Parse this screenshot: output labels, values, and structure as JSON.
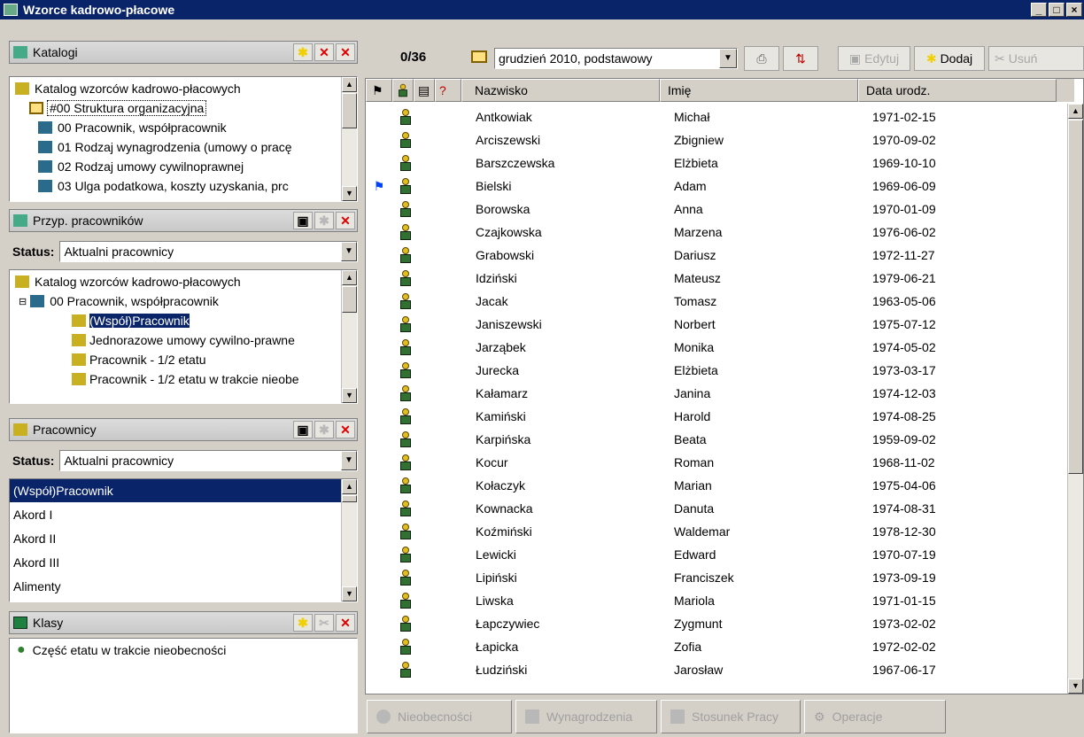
{
  "window": {
    "title": "Wzorce kadrowo-płacowe"
  },
  "katalogi": {
    "title": "Katalogi",
    "items": [
      "Katalog wzorców kadrowo-płacowych",
      "#00 Struktura organizacyjna",
      "00 Pracownik, współpracownik",
      "01 Rodzaj wynagrodzenia (umowy o pracę",
      "02 Rodzaj umowy cywilnoprawnej",
      "03 Ulga podatkowa, koszty uzyskania, prc"
    ]
  },
  "przyp": {
    "title": "Przyp. pracowników",
    "status_label": "Status:",
    "status_value": "Aktualni pracownicy",
    "items": [
      "Katalog wzorców kadrowo-płacowych",
      "00 Pracownik, współpracownik",
      "(Współ)Pracownik",
      "Jednorazowe umowy cywilno-prawne",
      "Pracownik - 1/2 etatu",
      "Pracownik - 1/2 etatu w trakcie nieobe"
    ]
  },
  "pracownicy": {
    "title": "Pracownicy",
    "status_label": "Status:",
    "status_value": "Aktualni pracownicy",
    "items": [
      "(Współ)Pracownik",
      "Akord I",
      "Akord II",
      "Akord III",
      "Alimenty"
    ]
  },
  "klasy": {
    "title": "Klasy",
    "items": [
      "Część etatu w trakcie nieobecności"
    ]
  },
  "toolbar": {
    "counter": "0/36",
    "period": "grudzień 2010, podstawowy",
    "edit_label": "Edytuj",
    "add_label": "Dodaj",
    "delete_label": "Usuń"
  },
  "grid": {
    "columns": [
      "Nazwisko",
      "Imię",
      "Data urodz."
    ],
    "rows": [
      {
        "last": "Antkowiak",
        "first": "Michał",
        "date": "1971-02-15"
      },
      {
        "last": "Arciszewski",
        "first": "Zbigniew",
        "date": "1970-09-02"
      },
      {
        "last": "Barszczewska",
        "first": "Elżbieta",
        "date": "1969-10-10"
      },
      {
        "last": "Bielski",
        "first": "Adam",
        "date": "1969-06-09",
        "flag": true
      },
      {
        "last": "Borowska",
        "first": "Anna",
        "date": "1970-01-09"
      },
      {
        "last": "Czajkowska",
        "first": "Marzena",
        "date": "1976-06-02"
      },
      {
        "last": "Grabowski",
        "first": "Dariusz",
        "date": "1972-11-27"
      },
      {
        "last": "Idziński",
        "first": "Mateusz",
        "date": "1979-06-21"
      },
      {
        "last": "Jacak",
        "first": "Tomasz",
        "date": "1963-05-06"
      },
      {
        "last": "Janiszewski",
        "first": "Norbert",
        "date": "1975-07-12"
      },
      {
        "last": "Jarząbek",
        "first": "Monika",
        "date": "1974-05-02"
      },
      {
        "last": "Jurecka",
        "first": "Elżbieta",
        "date": "1973-03-17"
      },
      {
        "last": "Kałamarz",
        "first": "Janina",
        "date": "1974-12-03"
      },
      {
        "last": "Kamiński",
        "first": "Harold",
        "date": "1974-08-25"
      },
      {
        "last": "Karpińska",
        "first": "Beata",
        "date": "1959-09-02"
      },
      {
        "last": "Kocur",
        "first": "Roman",
        "date": "1968-11-02"
      },
      {
        "last": "Kołaczyk",
        "first": "Marian",
        "date": "1975-04-06"
      },
      {
        "last": "Kownacka",
        "first": "Danuta",
        "date": "1974-08-31"
      },
      {
        "last": "Koźmiński",
        "first": "Waldemar",
        "date": "1978-12-30"
      },
      {
        "last": "Lewicki",
        "first": "Edward",
        "date": "1970-07-19"
      },
      {
        "last": "Lipiński",
        "first": "Franciszek",
        "date": "1973-09-19"
      },
      {
        "last": "Liwska",
        "first": "Mariola",
        "date": "1971-01-15"
      },
      {
        "last": "Łapczywiec",
        "first": "Zygmunt",
        "date": "1973-02-02"
      },
      {
        "last": "Łapicka",
        "first": "Zofia",
        "date": "1972-02-02"
      },
      {
        "last": "Łudziński",
        "first": "Jarosław",
        "date": "1967-06-17"
      }
    ]
  },
  "bottom": {
    "nieobecnosci": "Nieobecności",
    "wynagrodzenia": "Wynagrodzenia",
    "stosunek": "Stosunek Pracy",
    "operacje": "Operacje"
  }
}
